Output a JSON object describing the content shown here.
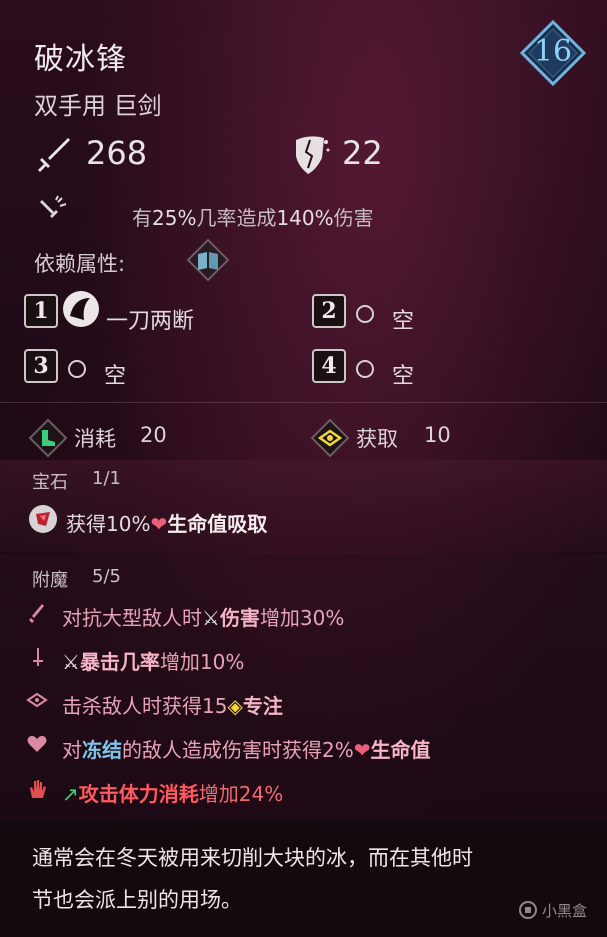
{
  "item": {
    "name": "破冰锋",
    "type": "双手用 巨剑",
    "level": "16"
  },
  "stats": {
    "damage": "268",
    "stagger": "22",
    "crit_text_prefix": "有",
    "crit_chance": "25%",
    "crit_text_mid": "几率造成",
    "crit_damage": "140%",
    "crit_text_suffix": "伤害"
  },
  "attributes": {
    "label": "依赖属性:"
  },
  "slots": [
    {
      "num": "1",
      "label": "一刀两断"
    },
    {
      "num": "2",
      "label": "空"
    },
    {
      "num": "3",
      "label": "空"
    },
    {
      "num": "4",
      "label": "空"
    }
  ],
  "costs": {
    "consume_label": "消耗",
    "consume_value": "20",
    "gain_label": "获取",
    "gain_value": "10"
  },
  "gem": {
    "label": "宝石",
    "count": "1/1",
    "text_prefix": "获得10%",
    "text_highlight": "生命值吸取"
  },
  "enchant": {
    "label": "附魔",
    "count": "5/5",
    "lines": [
      {
        "a": "对抗大型敌人时",
        "b": "伤害",
        "c": "增加30%"
      },
      {
        "a": "",
        "b": "暴击几率",
        "c": "增加10%"
      },
      {
        "a": "击杀敌人时获得15",
        "b": "专注",
        "c": ""
      },
      {
        "a": "对",
        "blue": "冻结",
        "a2": "的敌人造成伤害时获得2%",
        "b": "生命值",
        "c": ""
      },
      {
        "a": "",
        "b": "攻击体力消耗",
        "c": "增加24%"
      }
    ]
  },
  "lore": {
    "line1": "通常会在冬天被用来切削大块的冰，而在其他时",
    "line2": "节也会派上别的用场。"
  },
  "watermark": "小黑盒",
  "colors": {
    "enchant_text": "#e6a3b7",
    "enchant_red": "#ef6b6f",
    "enchant_blue": "#7fc6ea",
    "badge_blue": "#5aa9d8"
  }
}
